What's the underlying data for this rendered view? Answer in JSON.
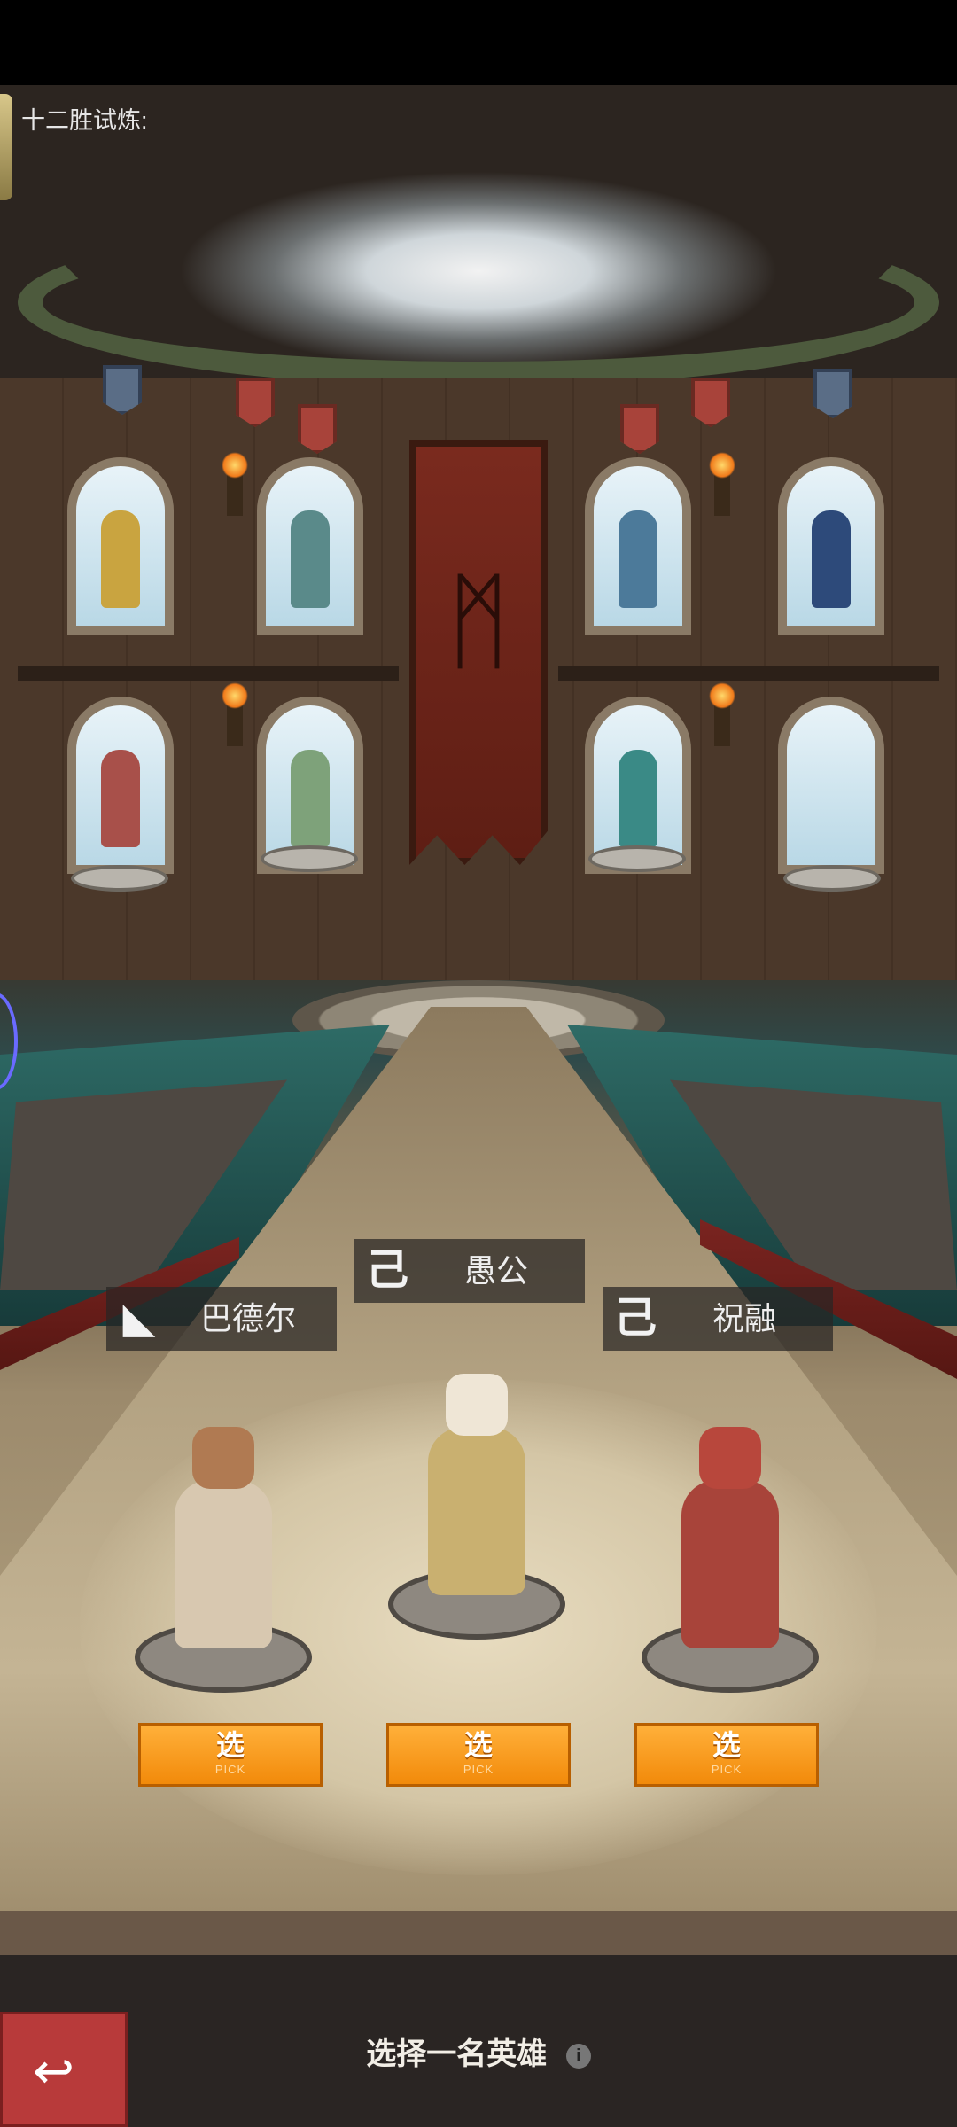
{
  "header": {
    "title": "十二胜试炼:"
  },
  "heroes": [
    {
      "name": "巴德尔",
      "emblem": "wolf-emblem",
      "emblem_glyph": "◣",
      "pick_label": "选",
      "pick_sub": "PICK",
      "color": "#8a6a4a"
    },
    {
      "name": "愚公",
      "emblem": "serpent-emblem",
      "emblem_glyph": "己",
      "pick_label": "选",
      "pick_sub": "PICK",
      "color": "#c9b070"
    },
    {
      "name": "祝融",
      "emblem": "serpent-emblem",
      "emblem_glyph": "己",
      "pick_label": "选",
      "pick_sub": "PICK",
      "color": "#a8443a"
    }
  ],
  "footer": {
    "prompt": "选择一名英雄",
    "info_glyph": "i",
    "back_glyph": "↩"
  },
  "colors": {
    "pick_button": "#f49a1e",
    "back_button": "#b83a3a"
  }
}
